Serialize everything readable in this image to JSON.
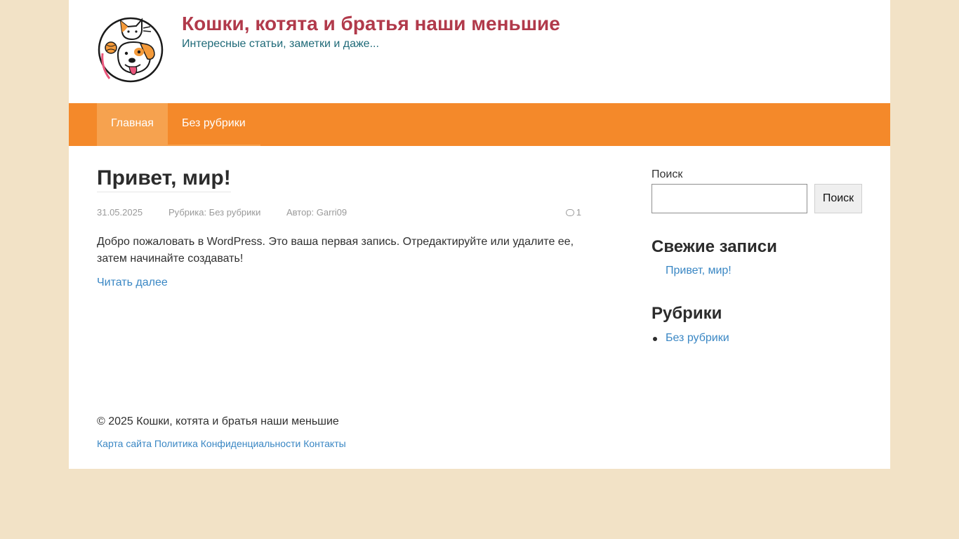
{
  "header": {
    "site_title": "Кошки, котята и братья наши меньшие",
    "site_description": "Интересные статьи, заметки и даже..."
  },
  "nav": {
    "items": [
      {
        "label": "Главная",
        "active": true
      },
      {
        "label": "Без рубрики",
        "active": false
      }
    ]
  },
  "post": {
    "title": "Привет, мир!",
    "date": "31.05.2025",
    "category": "Рубрика: Без рубрики",
    "author": "Автор: Garri09",
    "comments": "1",
    "excerpt": "Добро пожаловать в WordPress. Это ваша первая запись. Отредактируйте или удалите ее, затем начинайте создавать!",
    "read_more": "Читать далее"
  },
  "sidebar": {
    "search_label": "Поиск",
    "search_value": "",
    "search_button": "Поиск",
    "recent_title": "Свежие записи",
    "recent_items": [
      "Привет, мир!"
    ],
    "categories_title": "Рубрики",
    "categories": [
      "Без рубрики"
    ]
  },
  "footer": {
    "copyright": "© 2025 Кошки, котята и братья наши меньшие",
    "links": [
      "Карта сайта",
      "Политика Конфиденциальности",
      "Контакты"
    ]
  },
  "colors": {
    "background": "#f2e2c6",
    "nav": "#f4892a",
    "nav_active": "#f6a24f",
    "title": "#b13a4b",
    "description": "#1f6a78",
    "link": "#3a87c4"
  },
  "icons": {
    "logo": "cat-and-dog-logo",
    "comments": "comment-bubble-icon"
  }
}
